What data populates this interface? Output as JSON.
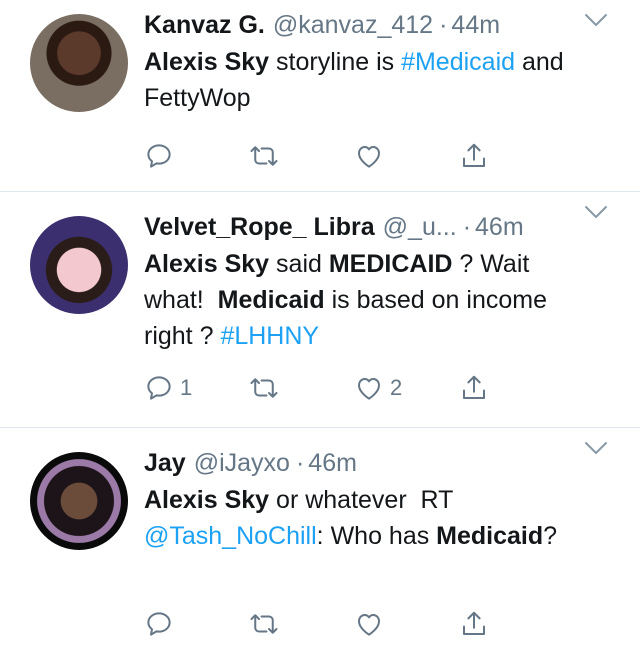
{
  "tweets": [
    {
      "name": "Kanvaz G.",
      "handle": "@kanvaz_412",
      "time": "44m",
      "text_parts": [
        "Alexis Sky",
        " storyline is ",
        "#Medicaid",
        " and FettyWop"
      ],
      "reply_count": "",
      "like_count": ""
    },
    {
      "name": "Velvet_Rope_ Libra",
      "handle": "@_u...",
      "time": "46m",
      "text_parts": [
        "Alexis Sky",
        " said ",
        "MEDICAID",
        " ? Wait what!  ",
        "Medicaid",
        " is based on income right ? ",
        "#LHHNY"
      ],
      "reply_count": "1",
      "like_count": "2"
    },
    {
      "name": "Jay",
      "handle": "@iJayxo",
      "time": "46m",
      "text_parts": [
        "Alexis Sky",
        " or whatever  RT ",
        "@Tash_NoChill",
        ": Who has ",
        "Medicaid",
        "?"
      ],
      "reply_count": "",
      "like_count": ""
    }
  ],
  "separator": "·",
  "icons": [
    "chevron-down-icon",
    "reply-icon",
    "retweet-icon",
    "like-icon",
    "share-icon"
  ],
  "colors": {
    "link": "#1da1f2",
    "muted": "#657786",
    "text": "#14171a",
    "border": "#e1e8ed"
  }
}
